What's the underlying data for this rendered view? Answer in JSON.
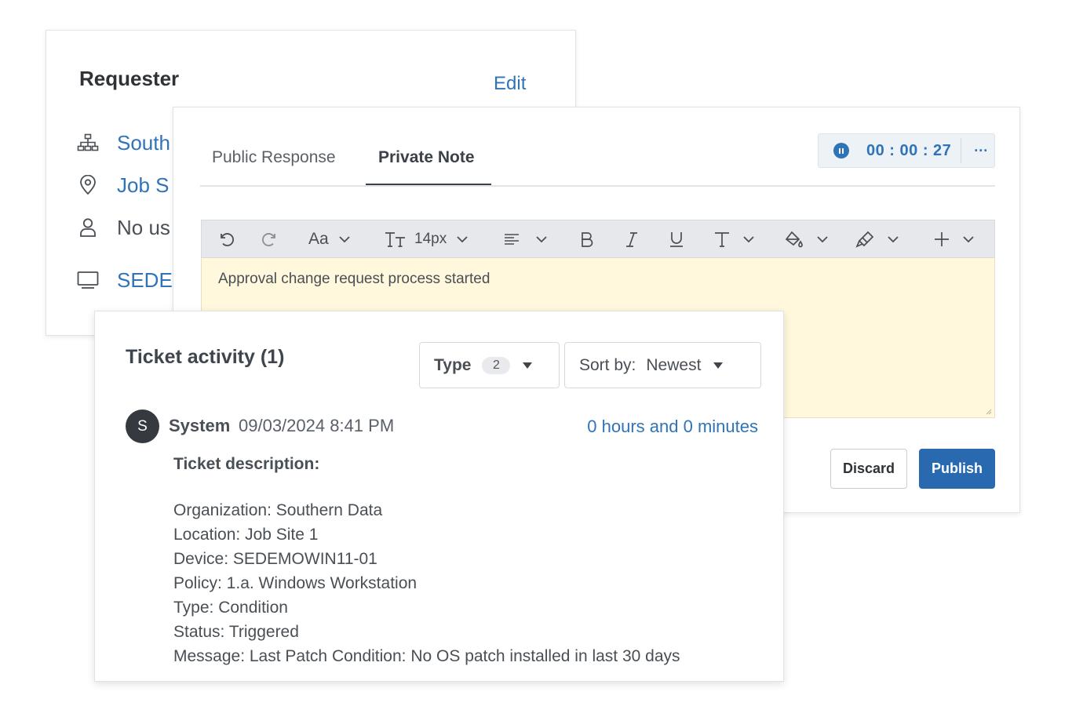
{
  "requester": {
    "title": "Requester",
    "edit_label": "Edit",
    "rows": [
      {
        "icon": "organization-icon",
        "text": "South"
      },
      {
        "icon": "location-pin-icon",
        "text": "Job S"
      },
      {
        "icon": "user-icon",
        "text": "No us"
      },
      {
        "icon": "monitor-icon",
        "text": "SEDE"
      }
    ]
  },
  "editor": {
    "tabs": [
      "Public Response",
      "Private Note"
    ],
    "active_tab": "Private Note",
    "timer": {
      "time": "00 : 00 : 27",
      "pause_icon": "pause-icon",
      "more_label": "···"
    },
    "toolbar": {
      "font_label": "Aa",
      "size_label": "14px",
      "icons": [
        "undo-icon",
        "redo-icon",
        "font-family-icon",
        "font-size-icon",
        "align-icon",
        "bold-icon",
        "italic-icon",
        "underline-icon",
        "text-format-icon",
        "fill-color-icon",
        "highlight-icon",
        "insert-icon"
      ]
    },
    "content": "Approval change request process started",
    "discard_label": "Discard",
    "publish_label": "Publish",
    "colors": {
      "accent": "#2f73b8",
      "note_bg": "#fff8dc",
      "publish_bg": "#2969b0"
    }
  },
  "activity": {
    "title": "Ticket activity (1)",
    "type_filter": {
      "label": "Type",
      "count": "2"
    },
    "sort": {
      "label": "Sort by:",
      "value": "Newest"
    },
    "entry": {
      "avatar_letter": "S",
      "author": "System",
      "date": "09/03/2024 8:41 PM",
      "duration": "0 hours and 0 minutes",
      "heading": "Ticket description:",
      "lines": [
        "Organization: Southern Data",
        "Location: Job Site 1",
        "Device: SEDEMOWIN11-01",
        "Policy: 1.a. Windows Workstation",
        "Type: Condition",
        "Status: Triggered",
        "Message: Last Patch Condition: No OS patch installed in last 30 days"
      ]
    }
  }
}
